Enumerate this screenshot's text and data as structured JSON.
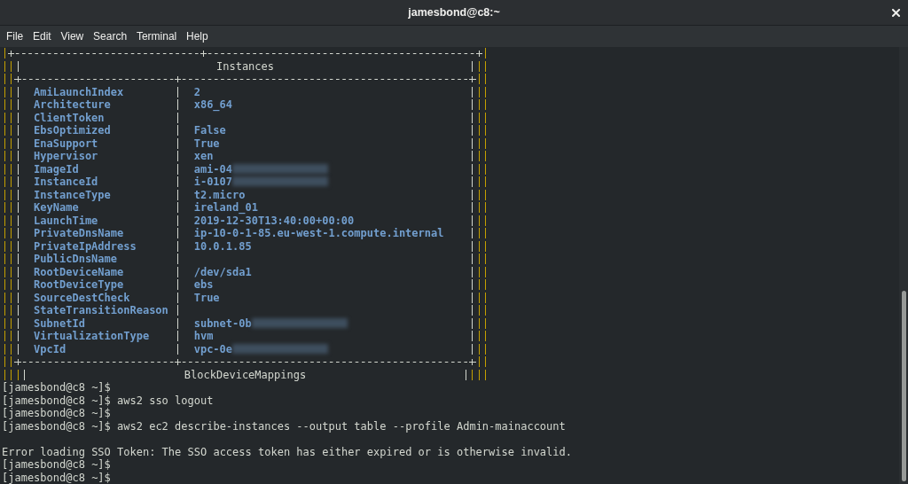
{
  "window": {
    "title": "jamesbond@c8:~"
  },
  "menu": [
    "File",
    "Edit",
    "View",
    "Search",
    "Terminal",
    "Help"
  ],
  "terminal": {
    "instances_table": {
      "title": "Instances",
      "rows": [
        {
          "key": "AmiLaunchIndex",
          "value": "2",
          "redacted": false
        },
        {
          "key": "Architecture",
          "value": "x86_64",
          "redacted": false
        },
        {
          "key": "ClientToken",
          "redacted": false
        },
        {
          "key": "EbsOptimized",
          "value": "False",
          "redacted": false
        },
        {
          "key": "EnaSupport",
          "value": "True",
          "redacted": false
        },
        {
          "key": "Hypervisor",
          "value": "xen",
          "redacted": false
        },
        {
          "key": "ImageId",
          "value": "ami-04",
          "redacted": true
        },
        {
          "key": "InstanceId",
          "value": "i-0107",
          "redacted": true
        },
        {
          "key": "InstanceType",
          "value": "t2.micro",
          "redacted": false
        },
        {
          "key": "KeyName",
          "value": "ireland_01",
          "redacted": false
        },
        {
          "key": "LaunchTime",
          "value": "2019-12-30T13:40:00+00:00",
          "redacted": false
        },
        {
          "key": "PrivateDnsName",
          "value": "ip-10-0-1-85.eu-west-1.compute.internal",
          "redacted": false
        },
        {
          "key": "PrivateIpAddress",
          "value": "10.0.1.85",
          "redacted": false
        },
        {
          "key": "PublicDnsName",
          "redacted": false
        },
        {
          "key": "RootDeviceName",
          "value": "/dev/sda1",
          "redacted": false
        },
        {
          "key": "RootDeviceType",
          "value": "ebs",
          "redacted": false
        },
        {
          "key": "SourceDestCheck",
          "value": "True",
          "redacted": false
        },
        {
          "key": "StateTransitionReason",
          "redacted": false
        },
        {
          "key": "SubnetId",
          "value": "subnet-0b",
          "redacted": true
        },
        {
          "key": "VirtualizationType",
          "value": "hvm",
          "redacted": false
        },
        {
          "key": "VpcId",
          "value": "vpc-0e",
          "redacted": true
        }
      ]
    },
    "next_table": {
      "title": "BlockDeviceMappings"
    },
    "lines": [
      {
        "kind": "prompt",
        "prompt": "[jamesbond@c8 ~]$"
      },
      {
        "kind": "prompt",
        "prompt": "[jamesbond@c8 ~]$",
        "command": "aws2 sso logout"
      },
      {
        "kind": "prompt",
        "prompt": "[jamesbond@c8 ~]$"
      },
      {
        "kind": "prompt",
        "prompt": "[jamesbond@c8 ~]$",
        "command": "aws2 ec2 describe-instances --output table --profile Admin-mainaccount"
      },
      {
        "kind": "blank"
      },
      {
        "kind": "output",
        "text": "Error loading SSO Token: The SSO access token has either expired or is otherwise invalid."
      },
      {
        "kind": "prompt",
        "prompt": "[jamesbond@c8 ~]$"
      },
      {
        "kind": "prompt",
        "prompt": "[jamesbond@c8 ~]$"
      }
    ]
  }
}
